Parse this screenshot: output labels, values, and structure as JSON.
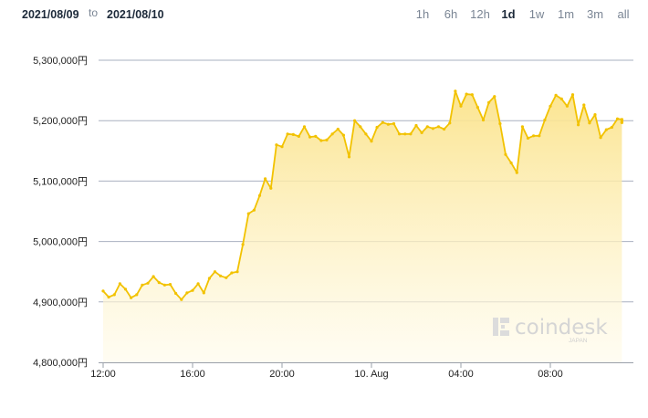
{
  "header": {
    "date_from": "2021/08/09",
    "date_separator": "to",
    "date_to": "2021/08/10",
    "ranges": [
      "1h",
      "6h",
      "12h",
      "1d",
      "1w",
      "1m",
      "3m",
      "all"
    ],
    "active_range": "1d"
  },
  "watermark": {
    "brand": "coindesk",
    "sub": "JAPAN"
  },
  "colors": {
    "line": "#f2c200",
    "fill_top": "#fbe38a",
    "fill_bottom": "#fffbea",
    "grid": "#aab0c0",
    "axis": "#9aa0aa"
  },
  "chart_data": {
    "type": "area",
    "title": "",
    "xlabel": "",
    "ylabel": "",
    "y_unit": "円",
    "ylim": [
      4800000,
      5300000
    ],
    "yticks": [
      "5,300,000円",
      "5,200,000円",
      "5,100,000円",
      "5,000,000円",
      "4,900,000円",
      "4,800,000円"
    ],
    "ytick_values": [
      5300000,
      5200000,
      5100000,
      5000000,
      4900000,
      4800000
    ],
    "x_hours_range": [
      12,
      35
    ],
    "xtick_values": [
      12,
      16,
      20,
      24,
      28,
      32
    ],
    "xticks": [
      "12:00",
      "16:00",
      "20:00",
      "10. Aug",
      "04:00",
      "08:00"
    ],
    "grid": true,
    "legend": "none",
    "series": [
      {
        "x": [
          12.0,
          12.25,
          12.5,
          12.75,
          13.0,
          13.25,
          13.5,
          13.75,
          14.0,
          14.25,
          14.5,
          14.75,
          15.0,
          15.25,
          15.5,
          15.75,
          16.0,
          16.25,
          16.5,
          16.75,
          17.0,
          17.25,
          17.5,
          17.75,
          18.0,
          18.25,
          18.5,
          18.75,
          19.0,
          19.25,
          19.5,
          19.75,
          20.0,
          20.25,
          20.5,
          20.75,
          21.0,
          21.25,
          21.5,
          21.75,
          22.0,
          22.25,
          22.5,
          22.75,
          23.0,
          23.25,
          23.5,
          23.75,
          24.0,
          24.25,
          24.5,
          24.75,
          25.0,
          25.25,
          25.5,
          25.75,
          26.0,
          26.25,
          26.5,
          26.75,
          27.0,
          27.25,
          27.5,
          27.75,
          28.0,
          28.25,
          28.5,
          28.75,
          29.0,
          29.25,
          29.5,
          29.75,
          30.0,
          30.25,
          30.5,
          30.75,
          31.0,
          31.25,
          31.5,
          31.75,
          32.0,
          32.25,
          32.5,
          32.75,
          33.0,
          33.25,
          33.5,
          33.75,
          34.0,
          34.25,
          34.5,
          34.75,
          35.0,
          35.25,
          35.5,
          35.75,
          36.0,
          36.25
        ],
        "y": [
          4918000,
          4908000,
          4912000,
          4930000,
          4921000,
          4907000,
          4912000,
          4928000,
          4931000,
          4942000,
          4932000,
          4928000,
          4929000,
          4914000,
          4904000,
          4915000,
          4919000,
          4930000,
          4915000,
          4939000,
          4950000,
          4943000,
          4940000,
          4948000,
          4950000,
          4995000,
          5046000,
          5052000,
          5076000,
          5104000,
          5088000,
          5160000,
          5157000,
          5178000,
          5177000,
          5174000,
          5190000,
          5173000,
          5174000,
          5167000,
          5168000,
          5178000,
          5186000,
          5176000,
          5140000,
          5200000,
          5190000,
          5178000,
          5166000,
          5189000,
          5197000,
          5194000,
          5195000,
          5178000,
          5178000,
          5178000,
          5192000,
          5180000,
          5190000,
          5187000,
          5190000,
          5186000,
          5196000,
          5249000,
          5224000,
          5244000,
          5243000,
          5222000,
          5201000,
          5230000,
          5240000,
          5195000,
          5144000,
          5130000,
          5114000,
          5190000,
          5171000,
          5175000,
          5175000,
          5201000,
          5224000,
          5242000,
          5236000,
          5224000,
          5243000,
          5193000,
          5226000,
          5196000,
          5210000,
          5172000,
          5185000,
          5189000,
          5203000,
          5202000,
          5200000,
          5198000,
          5197000,
          5197000
        ]
      }
    ]
  }
}
